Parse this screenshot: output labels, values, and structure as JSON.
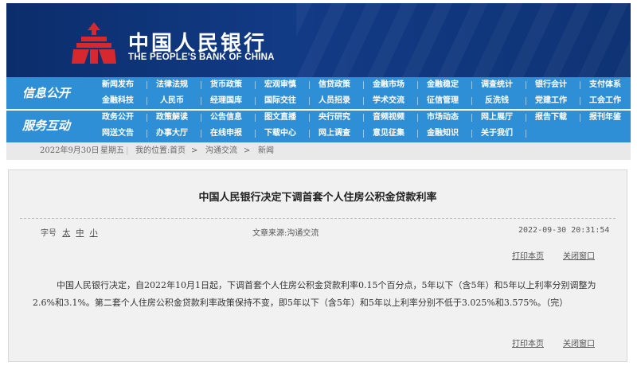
{
  "brand": {
    "name_cn": "中国人民银行",
    "name_en": "THE PEOPLE'S BANK OF CHINA"
  },
  "nav": {
    "sections": [
      {
        "title": "信息公开",
        "items": [
          "新闻发布",
          "法律法规",
          "货币政策",
          "宏观审慎",
          "信贷政策",
          "金融市场",
          "金融稳定",
          "调查统计",
          "银行会计",
          "支付体系",
          "金融科技",
          "人民币",
          "经理国库",
          "国际交往",
          "人员招录",
          "学术交流",
          "征信管理",
          "反洗钱",
          "党建工作",
          "工会工作"
        ]
      },
      {
        "title": "服务互动",
        "items": [
          "政务公开",
          "政策解读",
          "公告信息",
          "图文直播",
          "央行研究",
          "音频视频",
          "市场动态",
          "网上展厅",
          "报告下载",
          "报刊年鉴",
          "网送文告",
          "办事大厅",
          "在线申报",
          "下载中心",
          "网上调查",
          "意见征集",
          "金融知识",
          "关于我们"
        ]
      }
    ]
  },
  "breadcrumb": {
    "date": "2022年9月30日",
    "weekday": "星期五",
    "location_label": "我的位置:",
    "home": "首页",
    "level1": "沟通交流",
    "level2": "新闻"
  },
  "article": {
    "title": "中国人民银行决定下调首套个人住房公积金贷款利率",
    "font_size_label": "字号",
    "font_sizes": [
      "太",
      "中",
      "小"
    ],
    "source": "文章来源:沟通交流",
    "datetime": "2022-09-30 20:31:54",
    "print_label": "打印本页",
    "close_label": "关闭窗口",
    "body": "中国人民银行决定，自2022年10月1日起，下调首套个人住房公积金贷款利率0.15个百分点，5年以下（含5年）和5年以上利率分别调整为2.6%和3.1%。第二套个人住房公积金贷款利率政策保持不变，即5年以下（含5年）和5年以上利率分别不低于3.025%和3.575%。（完）"
  },
  "colors": {
    "banner": "#123b86",
    "nav": "#2f8fd6",
    "logo": "#d7282f",
    "panel": "#f1f1f1"
  }
}
